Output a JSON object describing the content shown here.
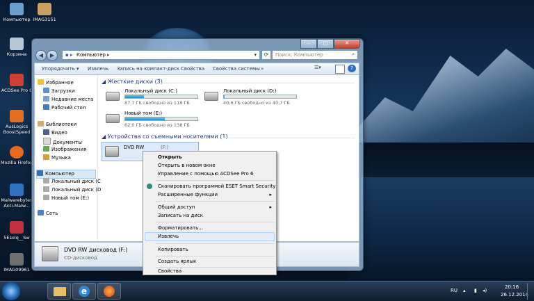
{
  "desktop": {
    "icons": [
      {
        "label": "Компьютер",
        "icon": "computer-icon",
        "color": "#6a9fd0"
      },
      {
        "label": "IMAG3151",
        "icon": "image-file-icon",
        "color": "#c8a060"
      },
      {
        "label": "Корзина",
        "icon": "recycle-bin-icon",
        "color": "#b8c8d8"
      },
      {
        "label": "ACDSee Pro 6",
        "icon": "acdsee-icon",
        "color": "#d04030"
      },
      {
        "label": "AusLogics BoostSpeed",
        "icon": "auslogics-icon",
        "color": "#e07020"
      },
      {
        "label": "Mozilla Firefox",
        "icon": "firefox-icon",
        "color": "#e86a1a"
      },
      {
        "label": "Malwarebytes Anti-Malw...",
        "icon": "malwarebytes-icon",
        "color": "#3070c0"
      },
      {
        "label": "5Esolq__Sw",
        "icon": "file-icon",
        "color": "#c03040"
      },
      {
        "label": "IMAG09961",
        "icon": "image-file-icon",
        "color": "#707070"
      }
    ]
  },
  "explorer": {
    "address": "Компьютер",
    "search_placeholder": "Поиск: Компьютер",
    "toolbar": {
      "organize": "Упорядочить ▾",
      "eject": "Извлечь",
      "burn": "Запись на компакт-диск",
      "properties": "Свойства",
      "system_properties": "Свойства системы",
      "more": "»"
    },
    "nav": {
      "favorites": "Избранное",
      "downloads": "Загрузки",
      "recent": "Недавние места",
      "desktop": "Рабочий стол",
      "libraries": "Библиотеки",
      "video": "Видео",
      "documents": "Документы",
      "images": "Изображения",
      "music": "Музыка",
      "computer": "Компьютер",
      "disk_c": "Локальный диск (C",
      "disk_d": "Локальный диск (D",
      "disk_e": "Новый том (E:)",
      "network": "Сеть"
    },
    "hard_drives_header": "Жесткие диски (3)",
    "drives": [
      {
        "name": "Локальный диск (C:)",
        "free": "87,7 ГБ свободно из 118 ГБ",
        "used_fraction": 0.26
      },
      {
        "name": "Локальный диск (D:)",
        "free": "40,6 ГБ свободно из 40,7 ГБ",
        "used_fraction": 0.01
      },
      {
        "name": "Новый том (E:)",
        "free": "62,0 ГБ свободно из 138 ГБ",
        "used_fraction": 0.55
      }
    ],
    "removable_header": "Устройства со съемными носителями (1)",
    "dvd_short": "DVD RW",
    "dvd_suffix": "(F:)",
    "details": {
      "name": "DVD RW дисковод (F:)",
      "type": "CD-дисковод"
    }
  },
  "context_menu": {
    "items": [
      "Открыть",
      "Открыть в новом окне",
      "Управление с помощью ACDSee Pro 6",
      "Сканировать программой ESET Smart Security",
      "Расширенные функции",
      "Общий доступ",
      "Записать на диск",
      "Форматировать...",
      "Извлечь",
      "Копировать",
      "Создать ярлык",
      "Свойства"
    ]
  },
  "taskbar": {
    "lang": "RU",
    "time": "20:16",
    "date": "26.12.2014"
  }
}
